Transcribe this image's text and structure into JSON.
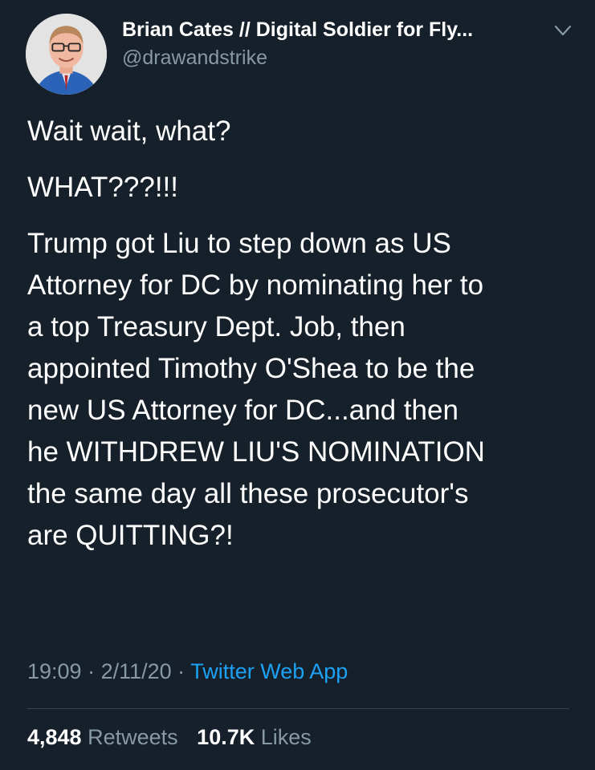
{
  "author": {
    "display_name": "Brian Cates // Digital Soldier for Fly...",
    "handle": "@drawandstrike"
  },
  "tweet": {
    "paragraphs": [
      "Wait wait, what?",
      "WHAT???!!!",
      "Trump got Liu to step down as US\nAttorney for DC by nominating her to\na top Treasury Dept. Job, then\nappointed Timothy O'Shea to be the\nnew US Attorney for DC...and then\nhe WITHDREW LIU'S NOMINATION\nthe same day all these prosecutor's\nare QUITTING?!"
    ],
    "time": "19:09",
    "separator": " · ",
    "date": "2/11/20",
    "source": "Twitter Web App"
  },
  "stats": {
    "retweets_count": "4,848",
    "retweets_label": "Retweets",
    "likes_count": "10.7K",
    "likes_label": "Likes"
  },
  "icons": {
    "avatar": "profile-photo",
    "menu": "chevron-down-icon"
  },
  "colors": {
    "background": "#15202b",
    "text": "#ffffff",
    "secondary": "#8899a6",
    "link": "#1da1f2",
    "divider": "#38444d"
  }
}
